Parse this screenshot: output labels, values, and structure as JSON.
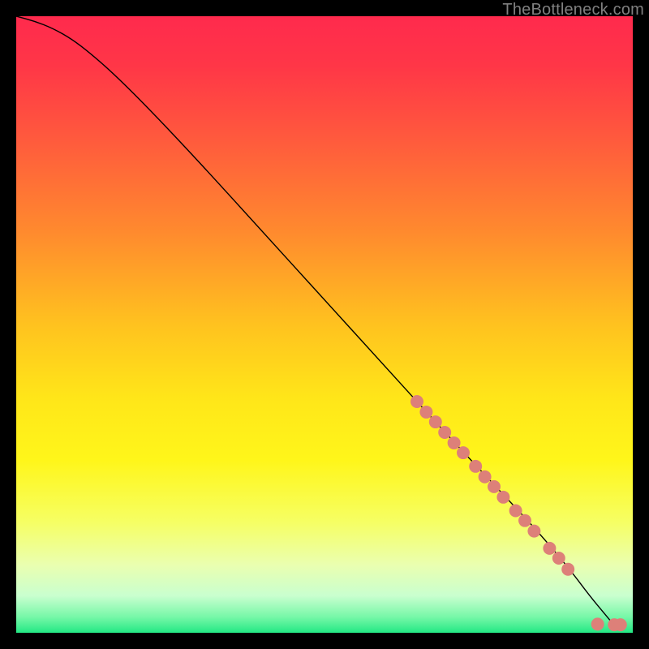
{
  "watermark": "TheBottleneck.com",
  "chart_data": {
    "type": "line",
    "title": "",
    "xlabel": "",
    "ylabel": "",
    "xlim": [
      0,
      100
    ],
    "ylim": [
      0,
      100
    ],
    "grid": false,
    "legend": false,
    "gradient_stops": [
      {
        "offset": 0.0,
        "color": "#ff2a4d"
      },
      {
        "offset": 0.08,
        "color": "#ff3647"
      },
      {
        "offset": 0.2,
        "color": "#ff5a3d"
      },
      {
        "offset": 0.35,
        "color": "#ff8a2e"
      },
      {
        "offset": 0.5,
        "color": "#ffc21f"
      },
      {
        "offset": 0.62,
        "color": "#ffe619"
      },
      {
        "offset": 0.72,
        "color": "#fff61a"
      },
      {
        "offset": 0.82,
        "color": "#f6ff63"
      },
      {
        "offset": 0.89,
        "color": "#eaffb0"
      },
      {
        "offset": 0.94,
        "color": "#c9ffcf"
      },
      {
        "offset": 0.975,
        "color": "#75f7a7"
      },
      {
        "offset": 1.0,
        "color": "#23e884"
      }
    ],
    "curve": {
      "x": [
        0,
        3,
        6,
        9,
        12,
        16,
        22,
        30,
        40,
        50,
        60,
        70,
        78,
        85,
        90,
        93,
        95.5,
        97,
        98
      ],
      "y": [
        100,
        99.2,
        98.0,
        96.3,
        94.0,
        90.5,
        84.5,
        76.0,
        65.0,
        54.0,
        43.0,
        32.0,
        23.5,
        16.0,
        10.0,
        6.0,
        3.0,
        1.2,
        1.2
      ]
    },
    "markers": [
      {
        "x": 65.0,
        "y": 37.5
      },
      {
        "x": 66.5,
        "y": 35.8
      },
      {
        "x": 68.0,
        "y": 34.2
      },
      {
        "x": 69.5,
        "y": 32.5
      },
      {
        "x": 71.0,
        "y": 30.8
      },
      {
        "x": 72.5,
        "y": 29.2
      },
      {
        "x": 74.5,
        "y": 27.0
      },
      {
        "x": 76.0,
        "y": 25.3
      },
      {
        "x": 77.5,
        "y": 23.7
      },
      {
        "x": 79.0,
        "y": 22.0
      },
      {
        "x": 81.0,
        "y": 19.8
      },
      {
        "x": 82.5,
        "y": 18.2
      },
      {
        "x": 84.0,
        "y": 16.5
      },
      {
        "x": 86.5,
        "y": 13.7
      },
      {
        "x": 88.0,
        "y": 12.1
      },
      {
        "x": 89.5,
        "y": 10.3
      },
      {
        "x": 94.3,
        "y": 1.4
      },
      {
        "x": 97.0,
        "y": 1.3
      },
      {
        "x": 98.0,
        "y": 1.3
      }
    ],
    "marker_color": "#dd8079",
    "line_color": "#000000"
  }
}
